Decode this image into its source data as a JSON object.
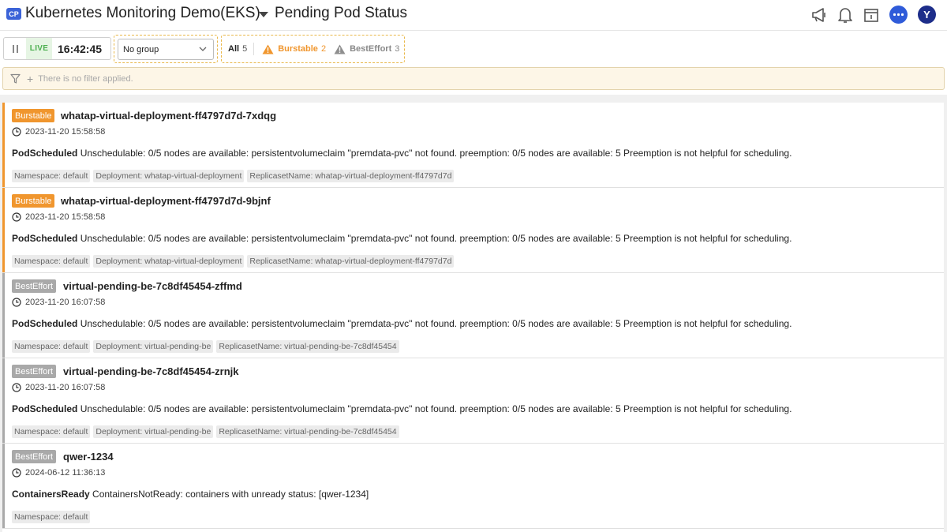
{
  "header": {
    "project_badge": "CP",
    "project_name": "Kubernetes Monitoring Demo(EKS)",
    "page_title": "Pending Pod Status",
    "avatar_letter": "Y"
  },
  "toolbar": {
    "live_label": "LIVE",
    "live_time": "16:42:45",
    "group_select_value": "No group",
    "filter_all_label": "All",
    "filter_all_count": "5",
    "filter_burstable_label": "Burstable",
    "filter_burstable_count": "2",
    "filter_besteffort_label": "BestEffort",
    "filter_besteffort_count": "3"
  },
  "filter_bar": {
    "text": "There is no filter applied."
  },
  "pods": [
    {
      "qos": "Burstable",
      "name": "whatap-virtual-deployment-ff4797d7d-7xdqg",
      "time": "2023-11-20 15:58:58",
      "reason": "PodScheduled",
      "message": "Unschedulable: 0/5 nodes are available: persistentvolumeclaim \"premdata-pvc\" not found. preemption: 0/5 nodes are available: 5 Preemption is not helpful for scheduling.",
      "tags": [
        "Namespace: default",
        "Deployment: whatap-virtual-deployment",
        "ReplicasetName: whatap-virtual-deployment-ff4797d7d"
      ]
    },
    {
      "qos": "Burstable",
      "name": "whatap-virtual-deployment-ff4797d7d-9bjnf",
      "time": "2023-11-20 15:58:58",
      "reason": "PodScheduled",
      "message": "Unschedulable: 0/5 nodes are available: persistentvolumeclaim \"premdata-pvc\" not found. preemption: 0/5 nodes are available: 5 Preemption is not helpful for scheduling.",
      "tags": [
        "Namespace: default",
        "Deployment: whatap-virtual-deployment",
        "ReplicasetName: whatap-virtual-deployment-ff4797d7d"
      ]
    },
    {
      "qos": "BestEffort",
      "name": "virtual-pending-be-7c8df45454-zffmd",
      "time": "2023-11-20 16:07:58",
      "reason": "PodScheduled",
      "message": "Unschedulable: 0/5 nodes are available: persistentvolumeclaim \"premdata-pvc\" not found. preemption: 0/5 nodes are available: 5 Preemption is not helpful for scheduling.",
      "tags": [
        "Namespace: default",
        "Deployment: virtual-pending-be",
        "ReplicasetName: virtual-pending-be-7c8df45454"
      ]
    },
    {
      "qos": "BestEffort",
      "name": "virtual-pending-be-7c8df45454-zrnjk",
      "time": "2023-11-20 16:07:58",
      "reason": "PodScheduled",
      "message": "Unschedulable: 0/5 nodes are available: persistentvolumeclaim \"premdata-pvc\" not found. preemption: 0/5 nodes are available: 5 Preemption is not helpful for scheduling.",
      "tags": [
        "Namespace: default",
        "Deployment: virtual-pending-be",
        "ReplicasetName: virtual-pending-be-7c8df45454"
      ]
    },
    {
      "qos": "BestEffort",
      "name": "qwer-1234",
      "time": "2024-06-12 11:36:13",
      "reason": "ContainersReady",
      "message": "ContainersNotReady: containers with unready status: [qwer-1234]",
      "tags": [
        "Namespace: default"
      ]
    }
  ],
  "colors": {
    "burstable": "#f0962e",
    "besteffort": "#a9a9a9",
    "live_green": "#4caf50",
    "brand_blue": "#3b63d8"
  },
  "icons": {
    "header": [
      "megaphone-icon",
      "bell-icon",
      "calendar-icon",
      "chat-icon"
    ],
    "pod_time": "clock-icon",
    "filter_bar": [
      "funnel-icon",
      "plus-icon"
    ]
  }
}
